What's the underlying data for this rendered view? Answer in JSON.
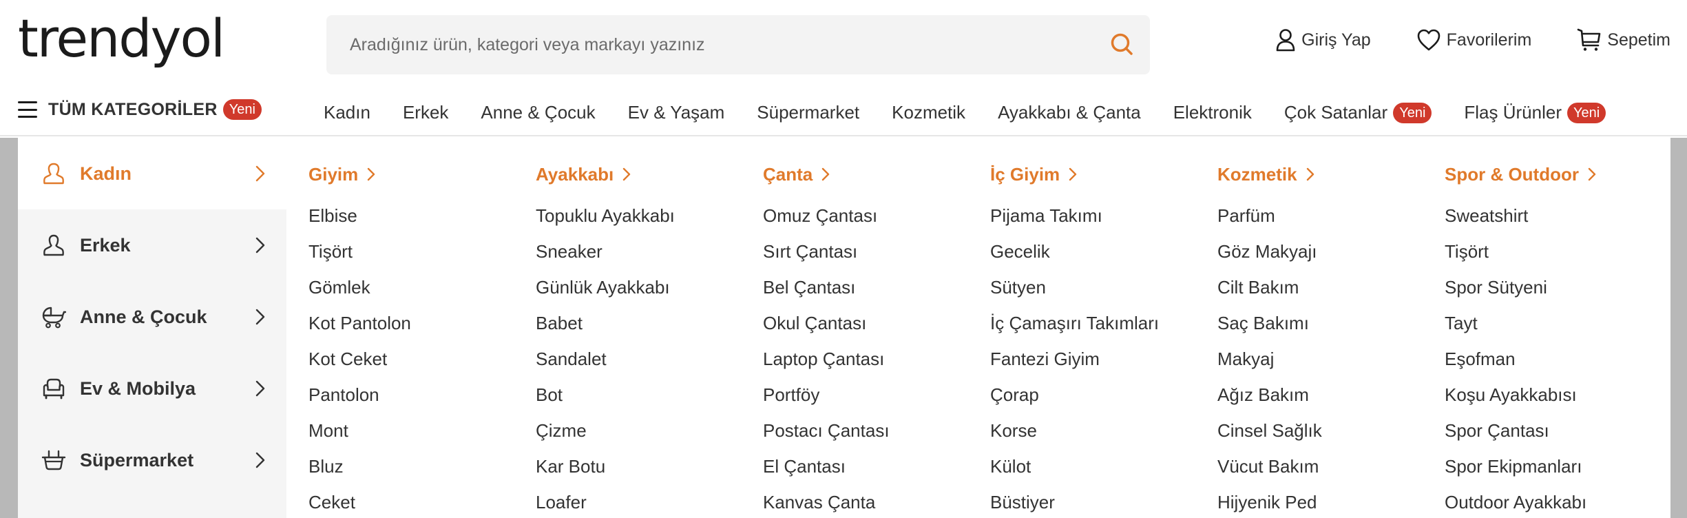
{
  "header": {
    "logo": "trendyol",
    "search": {
      "placeholder": "Aradığınız ürün, kategori veya markayı yazınız",
      "value": ""
    },
    "actions": [
      {
        "label": "Giriş Yap",
        "icon": "user-icon"
      },
      {
        "label": "Favorilerim",
        "icon": "heart-icon"
      },
      {
        "label": "Sepetim",
        "icon": "cart-icon"
      }
    ]
  },
  "nav": {
    "all_categories": {
      "label": "TÜM KATEGORİLER",
      "badge": "Yeni",
      "icon": "hamburger-menu-icon"
    },
    "links": [
      {
        "label": "Kadın"
      },
      {
        "label": "Erkek"
      },
      {
        "label": "Anne & Çocuk"
      },
      {
        "label": "Ev & Yaşam"
      },
      {
        "label": "Süpermarket"
      },
      {
        "label": "Kozmetik"
      },
      {
        "label": "Ayakkabı & Çanta"
      },
      {
        "label": "Elektronik"
      },
      {
        "label": "Çok Satanlar",
        "badge": "Yeni"
      },
      {
        "label": "Flaş Ürünler",
        "badge": "Yeni"
      }
    ]
  },
  "menu": {
    "sidebar": [
      {
        "label": "Kadın",
        "icon": "woman-icon",
        "active": true
      },
      {
        "label": "Erkek",
        "icon": "man-icon",
        "active": false
      },
      {
        "label": "Anne & Çocuk",
        "icon": "stroller-icon",
        "active": false
      },
      {
        "label": "Ev & Mobilya",
        "icon": "armchair-icon",
        "active": false
      },
      {
        "label": "Süpermarket",
        "icon": "basket-icon",
        "active": false
      }
    ],
    "columns": [
      {
        "title": "Giyim",
        "items": [
          "Elbise",
          "Tişört",
          "Gömlek",
          "Kot Pantolon",
          "Kot Ceket",
          "Pantolon",
          "Mont",
          "Bluz",
          "Ceket"
        ]
      },
      {
        "title": "Ayakkabı",
        "items": [
          "Topuklu Ayakkabı",
          "Sneaker",
          "Günlük Ayakkabı",
          "Babet",
          "Sandalet",
          "Bot",
          "Çizme",
          "Kar Botu",
          "Loafer"
        ]
      },
      {
        "title": "Çanta",
        "items": [
          "Omuz Çantası",
          "Sırt Çantası",
          "Bel Çantası",
          "Okul Çantası",
          "Laptop Çantası",
          "Portföy",
          "Postacı Çantası",
          "El Çantası",
          "Kanvas Çanta"
        ]
      },
      {
        "title": "İç Giyim",
        "items": [
          "Pijama Takımı",
          "Gecelik",
          "Sütyen",
          "İç Çamaşırı Takımları",
          "Fantezi Giyim",
          "Çorap",
          "Korse",
          "Külot",
          "Büstiyer"
        ]
      },
      {
        "title": "Kozmetik",
        "items": [
          "Parfüm",
          "Göz Makyajı",
          "Cilt Bakım",
          "Saç Bakımı",
          "Makyaj",
          "Ağız Bakım",
          "Cinsel Sağlık",
          "Vücut Bakım",
          "Hijyenik Ped"
        ]
      },
      {
        "title": "Spor & Outdoor",
        "items": [
          "Sweatshirt",
          "Tişört",
          "Spor Sütyeni",
          "Tayt",
          "Eşofman",
          "Koşu Ayakkabısı",
          "Spor Çantası",
          "Spor Ekipmanları",
          "Outdoor Ayakkabı"
        ]
      }
    ]
  },
  "colors": {
    "accent": "#e07a2b",
    "badge": "#d0392b",
    "text": "#333333",
    "search_bg": "#f3f3f3",
    "sidebar_bg": "#f5f5f5",
    "overlay": "#b8b8b8"
  }
}
